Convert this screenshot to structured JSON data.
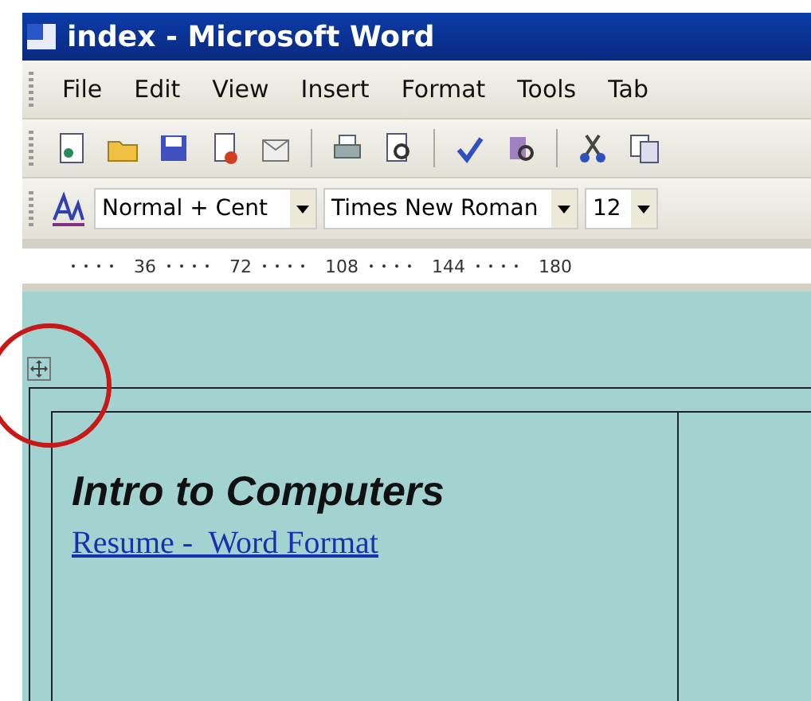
{
  "window": {
    "title": "index - Microsoft Word"
  },
  "menu": [
    "File",
    "Edit",
    "View",
    "Insert",
    "Format",
    "Tools",
    "Tab"
  ],
  "formatting_toolbar": {
    "style": "Normal + Cent",
    "font": "Times New Roman",
    "size": "12"
  },
  "ruler": {
    "labels": [
      "36",
      "72",
      "108",
      "144",
      "180"
    ]
  },
  "document": {
    "heading": "Intro to Computers",
    "link": "Resume -  Word Format"
  }
}
